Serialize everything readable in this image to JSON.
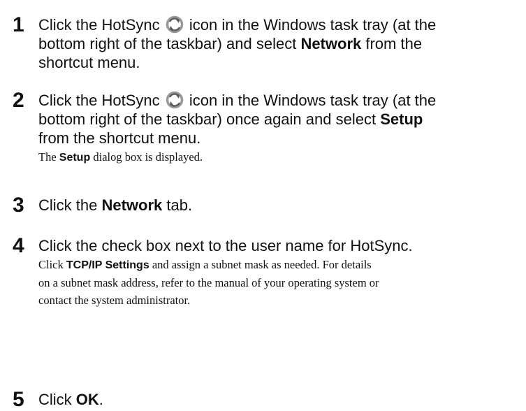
{
  "steps": [
    {
      "number": "1",
      "line1_a": "Click the HotSync",
      "line1_b": "icon in the Windows task tray (at the",
      "line2": "bottom right of the taskbar) and select",
      "bold1": "Network",
      "line2_b": "from the",
      "line3": "shortcut menu.",
      "icon": "hotsync-icon"
    },
    {
      "number": "2",
      "line1_a": "Click the HotSync",
      "line1_b": "icon in the Windows task tray (at the",
      "line2": "bottom right of the taskbar) once again and select",
      "bold1": "Setup",
      "line3": "from the shortcut menu.",
      "sub_a": "The",
      "sub_bold": "Setup",
      "sub_b": "dialog box is displayed.",
      "icon": "hotsync-icon"
    },
    {
      "number": "3",
      "text_a": "Click the",
      "bold": "Network",
      "text_b": "tab."
    },
    {
      "number": "4",
      "text": "Click the check box next to the user name for HotSync.",
      "sub_a": "Click",
      "sub_bold": "TCP/IP Settings",
      "sub_b": "and assign a subnet mask as needed. For details",
      "sub_line2": "on a subnet mask address, refer to the manual of your operating system or",
      "sub_line3": "contact the system administrator."
    },
    {
      "number": "5",
      "text_a": "Click",
      "bold": "OK",
      "text_b": "."
    }
  ]
}
